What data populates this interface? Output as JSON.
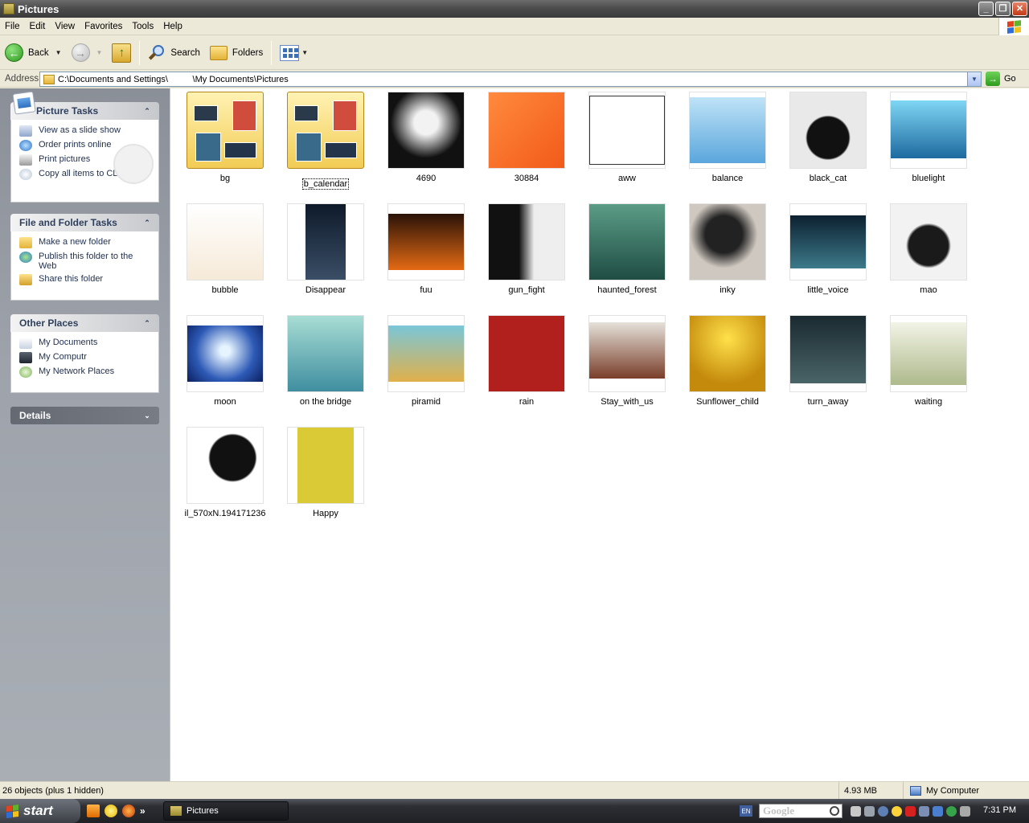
{
  "window": {
    "title": "Pictures"
  },
  "menu": [
    "File",
    "Edit",
    "View",
    "Favorites",
    "Tools",
    "Help"
  ],
  "toolbar": {
    "back": "Back",
    "search": "Search",
    "folders": "Folders"
  },
  "address": {
    "label": "Address",
    "path": "C:\\Documents and Settings\\          \\My Documents\\Pictures",
    "go": "Go"
  },
  "panels": {
    "picture_tasks": {
      "title": "Picture Tasks",
      "items": [
        "View as a slide show",
        "Order prints online",
        "Print pictures",
        "Copy all items to CD"
      ]
    },
    "file_tasks": {
      "title": "File and Folder Tasks",
      "items": [
        "Make a new folder",
        "Publish this folder to the Web",
        "Share this folder"
      ]
    },
    "other_places": {
      "title": "Other Places",
      "items": [
        "My Documents",
        "My Computr",
        "My Network Places"
      ]
    },
    "details": {
      "title": "Details"
    }
  },
  "files": [
    {
      "name": "bg",
      "kind": "folder"
    },
    {
      "name": "b_calendar",
      "kind": "folder",
      "selected": true
    },
    {
      "name": "4690"
    },
    {
      "name": "30884"
    },
    {
      "name": "aww"
    },
    {
      "name": "balance"
    },
    {
      "name": "black_cat"
    },
    {
      "name": "bluelight"
    },
    {
      "name": "bubble"
    },
    {
      "name": "Disappear"
    },
    {
      "name": "fuu"
    },
    {
      "name": "gun_fight"
    },
    {
      "name": "haunted_forest"
    },
    {
      "name": "inky"
    },
    {
      "name": "little_voice"
    },
    {
      "name": "mao"
    },
    {
      "name": "moon"
    },
    {
      "name": "on the bridge"
    },
    {
      "name": "piramid"
    },
    {
      "name": "rain"
    },
    {
      "name": "Stay_with_us"
    },
    {
      "name": "Sunflower_child"
    },
    {
      "name": "turn_away"
    },
    {
      "name": "waiting"
    },
    {
      "name": "il_570xN.194171236"
    },
    {
      "name": "Happy"
    }
  ],
  "status": {
    "objects": "26 objects (plus 1 hidden)",
    "size": "4.93 MB",
    "location": "My Computer"
  },
  "taskbar": {
    "start": "start",
    "task": "Pictures",
    "lang": "EN",
    "search_logo": "Google",
    "time": "7:31 PM"
  },
  "colors": {
    "accent": "#3d6fb5",
    "selection": "#316ac5"
  }
}
